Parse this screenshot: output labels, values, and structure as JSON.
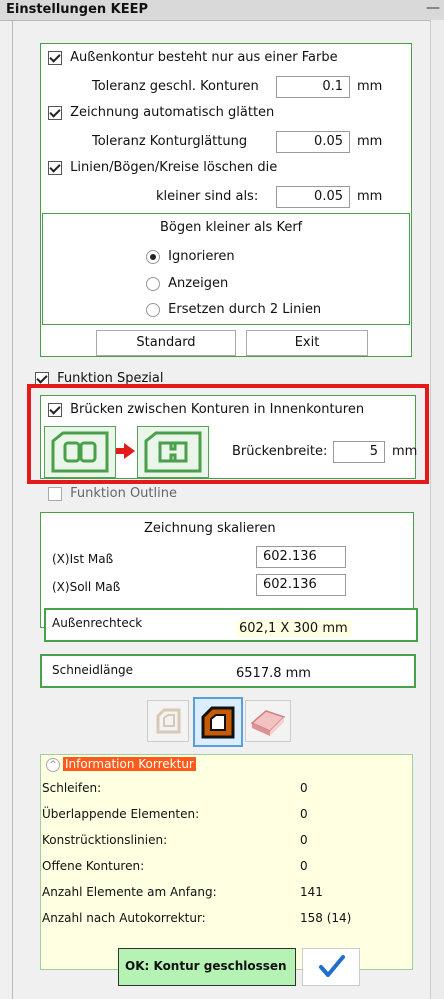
{
  "window": {
    "title": "Einstellungen KEEP",
    "minimize_glyph": "—"
  },
  "contour": {
    "aussenkontur_label": "Außenkontur besteht nur aus einer Farbe",
    "toleranz_label": "Toleranz geschl. Konturen",
    "toleranz_value": "0.1",
    "mm1": "mm",
    "glaetten_label": "Zeichnung automatisch glätten",
    "toleranz_glatt_label": "Toleranz Konturglättung",
    "toleranz_glatt_value": "0.05",
    "mm2": "mm",
    "loeschen_label": "Linien/Bögen/Kreise löschen die",
    "kleiner_label": "kleiner sind als:",
    "kleiner_value": "0.05",
    "mm3": "mm"
  },
  "kerf": {
    "title": "Bögen kleiner als Kerf",
    "options": [
      "Ignorieren",
      "Anzeigen",
      "Ersetzen durch 2 Linien"
    ],
    "selected": "Ignorieren"
  },
  "buttons": {
    "standard": "Standard",
    "exit": "Exit"
  },
  "spezial": {
    "label": "Funktion Spezial",
    "bruecken_label": "Brücken zwischen Konturen in Innenkonturen",
    "breite_label": "Brückenbreite:",
    "breite_value": "5",
    "mm": "mm",
    "outline_label": "Funktion Outline"
  },
  "skalieren": {
    "title": "Zeichnung skalieren",
    "ist_label": "(X)Ist Maß",
    "ist_value": "602.136",
    "soll_label": "(X)Soll Maß",
    "soll_value": "602.136",
    "rechteck_label": "Außenrechteck",
    "rechteck_value": "602,1 X 300 mm"
  },
  "schneid": {
    "label": "Schneidlänge",
    "value": "6517.8 mm"
  },
  "info": {
    "header": "Information Korrektur",
    "rows": [
      {
        "label": "Schleifen:",
        "value": "0"
      },
      {
        "label": "Überlappende Elementen:",
        "value": "0"
      },
      {
        "label": "Konstrücktionslinien:",
        "value": "0"
      },
      {
        "label": "Offene Konturen:",
        "value": "0"
      },
      {
        "label": "Anzahl Elemente am Anfang:",
        "value": "141"
      },
      {
        "label": "Anzahl nach Autokorrektur:",
        "value": "158 (14)"
      }
    ]
  },
  "status": {
    "ok_label": "OK: Kontur geschlossen",
    "check_icon": "checkmark-icon"
  },
  "colors": {
    "accent_green": "#4a9f4a",
    "highlight_red": "#e21a1a",
    "info_bg": "#ffffe1",
    "info_header_bg": "#ff5a1a",
    "ok_bg": "#b5f3b5"
  }
}
